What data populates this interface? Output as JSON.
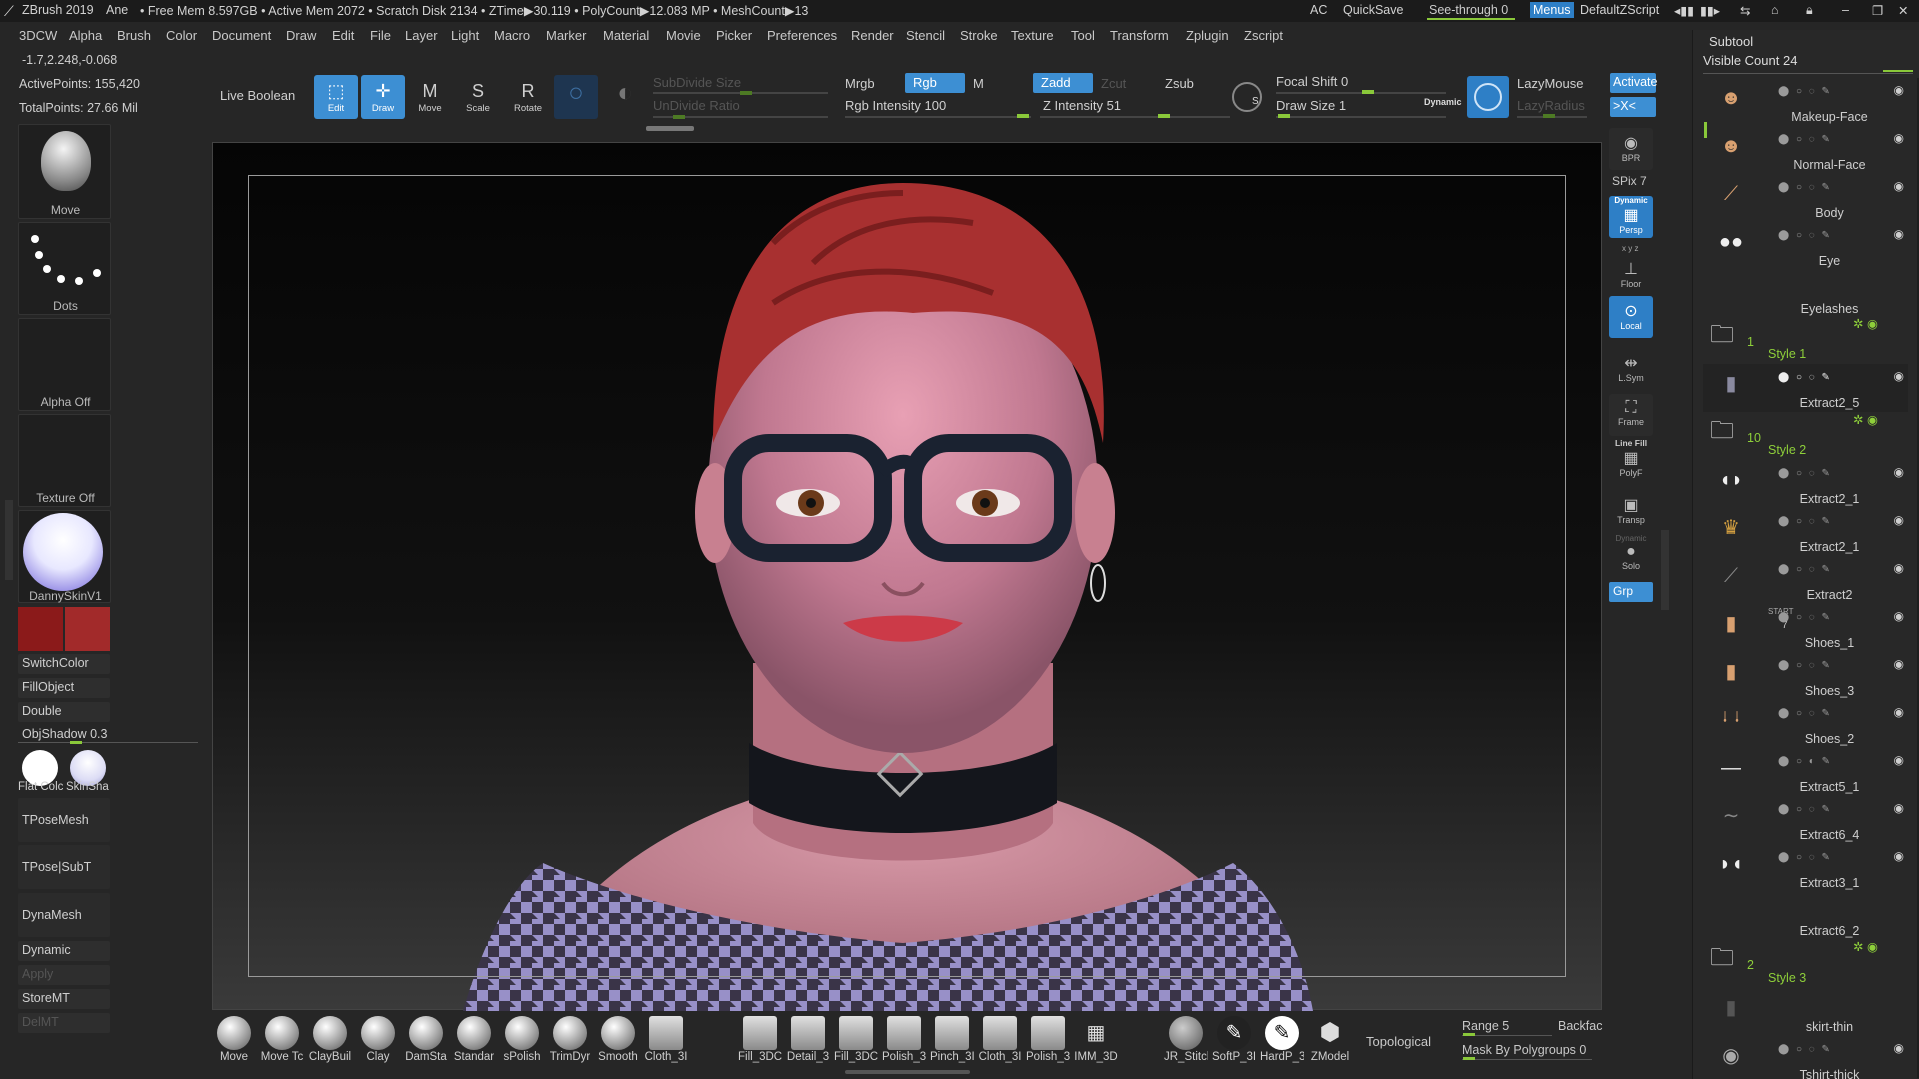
{
  "titlebar": {
    "app": "ZBrush 2019",
    "user": "Ane",
    "stats": "• Free Mem 8.597GB • Active Mem 2072 • Scratch Disk 2134 •  ZTime▶30.119 • PolyCount▶12.083 MP  • MeshCount▶13",
    "ac": "AC",
    "quicksave": "QuickSave",
    "seethrough": "See-through  0",
    "menus": "Menus",
    "script": "DefaultZScript"
  },
  "menubar": [
    "3DCW",
    "Alpha",
    "Brush",
    "Color",
    "Document",
    "Draw",
    "Edit",
    "File",
    "Layer",
    "Light",
    "Macro",
    "Marker",
    "Material",
    "Movie",
    "Picker",
    "Preferences",
    "Render",
    "Stencil",
    "Stroke",
    "Texture",
    "Tool",
    "Transform",
    "Zplugin",
    "Zscript"
  ],
  "left": {
    "coords": "-1.7,2.248,-0.068",
    "active_points": "ActivePoints: 155,420",
    "total_points": "TotalPoints: 27.66 Mil",
    "brush_label": "Move",
    "stroke_label": "Dots",
    "alpha_label": "Alpha Off",
    "texture_label": "Texture Off",
    "material_label": "DannySkinV1",
    "switchcolor": "SwitchColor",
    "fillobject": "FillObject",
    "double": "Double",
    "objshadow": "ObjShadow 0.3",
    "flatcolor": "Flat Colc",
    "skinshade": "SkinSha",
    "tposemesh": "TPoseMesh",
    "tposesubt": "TPose|SubT",
    "dynamesh": "DynaMesh",
    "dynamic": "Dynamic",
    "apply": "Apply",
    "storemt": "StoreMT",
    "delmt": "DelMT",
    "color_primary": "#8b1a1a",
    "color_secondary": "#a22a2a"
  },
  "toolbar": {
    "live_boolean": "Live Boolean",
    "edit": "Edit",
    "draw": "Draw",
    "move": "Move",
    "scale": "Scale",
    "rotate": "Rotate",
    "subdivide": "SubDivide Size",
    "undivide": "UnDivide Ratio",
    "mrgb": "Mrgb",
    "rgb": "Rgb",
    "m": "M",
    "rgb_intensity": "Rgb Intensity 100",
    "zadd": "Zadd",
    "zcut": "Zcut",
    "zsub": "Zsub",
    "z_intensity": "Z Intensity 51",
    "focal_shift": "Focal Shift 0",
    "draw_size": "Draw Size 1",
    "dynamic": "Dynamic",
    "lazymouse": "LazyMouse",
    "lazyradius": "LazyRadius",
    "activate": "Activate",
    "xc": ">X<"
  },
  "rightstrip": {
    "bpr": "BPR",
    "spix": "SPix 7",
    "persp": "Persp",
    "dynamic": "Dynamic",
    "xyz": "x y z",
    "floor": "Floor",
    "local": "Local",
    "lsym": "L.Sym",
    "frame": "Frame",
    "linefill": "Line Fill",
    "polyf": "PolyF",
    "transp": "Transp",
    "solo": "Solo",
    "grp": "Grp"
  },
  "subtool": {
    "title": "Subtool",
    "visible_count": "Visible Count 24",
    "items": [
      {
        "name": "Makeup-Face",
        "icon": "face-icon"
      },
      {
        "name": "Normal-Face",
        "icon": "face-icon"
      },
      {
        "name": "Body",
        "icon": "body-icon"
      },
      {
        "name": "Eye",
        "icon": "eye-icon"
      },
      {
        "name": "Eyelashes",
        "icon": "lash-icon"
      }
    ],
    "folder1": {
      "count": "1",
      "name": "Style 1"
    },
    "extract2_5": "Extract2_5",
    "folder2": {
      "count": "10",
      "name": "Style 2"
    },
    "items2": [
      "Extract2_1",
      "Extract2_1",
      "Extract2",
      "Shoes_1",
      "Shoes_3",
      "Shoes_2",
      "Extract5_1",
      "Extract6_4",
      "Extract3_1",
      "Extract6_2"
    ],
    "start": "START",
    "seven": "7",
    "folder3": {
      "count": "2",
      "name": "Style 3"
    },
    "skirt": "skirt-thin",
    "tshirt": "Tshirt-thick"
  },
  "bottom": {
    "brushes": [
      "Move",
      "Move Tc",
      "ClayBuil",
      "Clay",
      "DamSta",
      "Standar",
      "sPolish",
      "TrimDyr",
      "Smooth",
      "Cloth_3I",
      "Fill_3DC",
      "Detail_3",
      "Fill_3DC",
      "Polish_3",
      "Pinch_3I",
      "Cloth_3I",
      "Polish_3",
      "IMM_3D",
      "JR_Stitch",
      "SoftP_3I",
      "HardP_3",
      "ZModel"
    ],
    "topological": "Topological",
    "range": "Range 5",
    "backface": "Backfac",
    "mask": "Mask By Polygroups 0"
  }
}
